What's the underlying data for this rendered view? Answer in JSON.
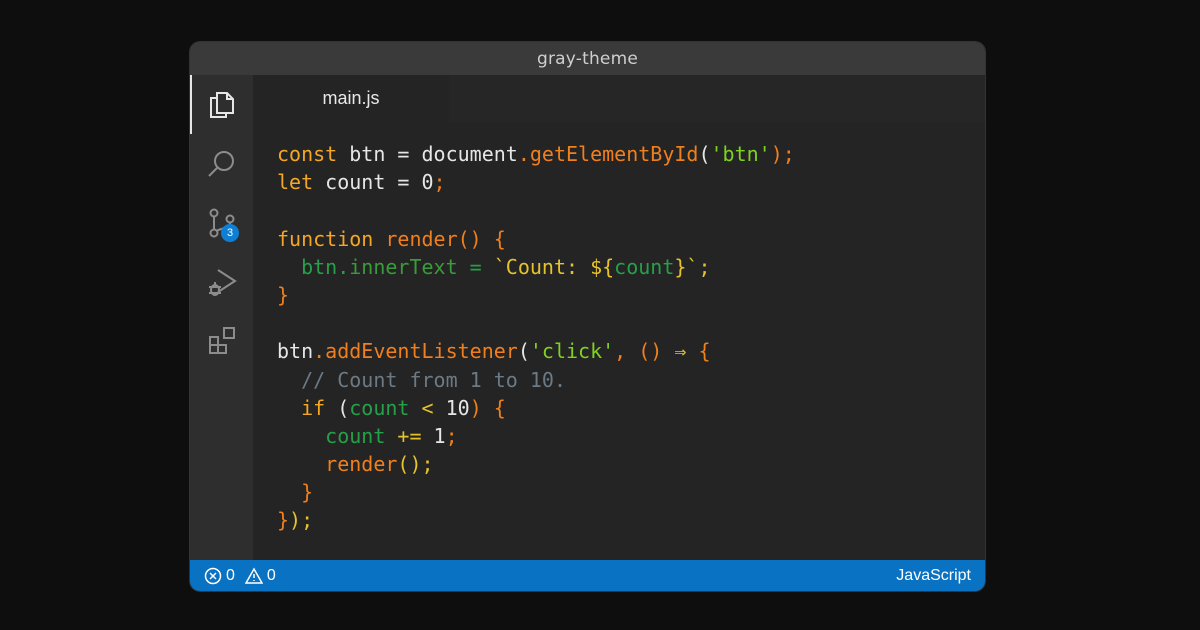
{
  "window": {
    "title": "gray-theme"
  },
  "activity_bar": {
    "items": [
      {
        "icon": "files-icon",
        "active": true
      },
      {
        "icon": "search-icon"
      },
      {
        "icon": "source-control-icon",
        "badge": "3"
      },
      {
        "icon": "run-debug-icon"
      },
      {
        "icon": "extensions-icon"
      }
    ]
  },
  "tabs": [
    {
      "label": "main.js",
      "active": true
    }
  ],
  "editor": {
    "language": "JavaScript",
    "lines": [
      [
        {
          "t": "const",
          "c": "kw"
        },
        {
          "t": " btn = document",
          "c": "pn"
        },
        {
          "t": ".",
          "c": "fn"
        },
        {
          "t": "getElementById",
          "c": "fn"
        },
        {
          "t": "(",
          "c": "pn"
        },
        {
          "t": "'btn'",
          "c": "str"
        },
        {
          "t": ");",
          "c": "fn"
        }
      ],
      [
        {
          "t": "let",
          "c": "kw"
        },
        {
          "t": " count = ",
          "c": "pn"
        },
        {
          "t": "0",
          "c": "num"
        },
        {
          "t": ";",
          "c": "fn"
        }
      ],
      [],
      [
        {
          "t": "function ",
          "c": "kw"
        },
        {
          "t": "render",
          "c": "fn"
        },
        {
          "t": "() {",
          "c": "fn"
        }
      ],
      [
        {
          "t": "  btn.",
          "c": "var"
        },
        {
          "t": "innerText",
          "c": "prop"
        },
        {
          "t": " = ",
          "c": "var"
        },
        {
          "t": "`Count: ${",
          "c": "op"
        },
        {
          "t": "count",
          "c": "var"
        },
        {
          "t": "}`;",
          "c": "op"
        }
      ],
      [
        {
          "t": "}",
          "c": "fn"
        }
      ],
      [],
      [
        {
          "t": "btn",
          "c": "pn"
        },
        {
          "t": ".addEventListener",
          "c": "fn"
        },
        {
          "t": "(",
          "c": "pn"
        },
        {
          "t": "'click'",
          "c": "str"
        },
        {
          "t": ", () ",
          "c": "fn"
        },
        {
          "t": "⇒",
          "c": "op"
        },
        {
          "t": " {",
          "c": "fn"
        }
      ],
      [
        {
          "t": "  // Count from 1 to 10.",
          "c": "cm"
        }
      ],
      [
        {
          "t": "  if ",
          "c": "kw"
        },
        {
          "t": "(",
          "c": "pn"
        },
        {
          "t": "count",
          "c": "var"
        },
        {
          "t": " < ",
          "c": "op"
        },
        {
          "t": "10",
          "c": "num"
        },
        {
          "t": ") {",
          "c": "fn"
        }
      ],
      [
        {
          "t": "    count",
          "c": "var"
        },
        {
          "t": " += ",
          "c": "op"
        },
        {
          "t": "1",
          "c": "num"
        },
        {
          "t": ";",
          "c": "fn"
        }
      ],
      [
        {
          "t": "    render",
          "c": "fn"
        },
        {
          "t": "();",
          "c": "op"
        }
      ],
      [
        {
          "t": "  }",
          "c": "fn"
        }
      ],
      [
        {
          "t": "}",
          "c": "fn"
        },
        {
          "t": ");",
          "c": "op"
        }
      ]
    ]
  },
  "status_bar": {
    "errors": "0",
    "warnings": "0",
    "language": "JavaScript"
  },
  "colors": {
    "status_bar": "#0a72c2",
    "badge": "#0f7fd6",
    "background": "#0e0e0e",
    "editor": "#242424"
  }
}
